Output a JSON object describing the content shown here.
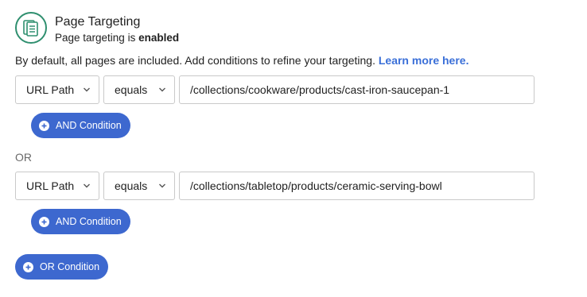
{
  "header": {
    "icon": "document-list-icon",
    "title": "Page Targeting",
    "subtitle_prefix": "Page targeting is ",
    "subtitle_status": "enabled"
  },
  "description": {
    "text": "By default, all pages are included. Add conditions to refine your targeting. ",
    "link": "Learn more here."
  },
  "groups": [
    {
      "field": "URL Path",
      "operator": "equals",
      "value": "/collections/cookware/products/cast-iron-saucepan-1",
      "and_label": "AND Condition"
    },
    {
      "field": "URL Path",
      "operator": "equals",
      "value": "/collections/tabletop/products/ceramic-serving-bowl",
      "and_label": "AND Condition"
    }
  ],
  "or_separator": "OR",
  "or_button": "OR Condition",
  "colors": {
    "accent": "#3d68cf",
    "icon_green": "#2f8f6f",
    "link": "#3a6fd8"
  }
}
